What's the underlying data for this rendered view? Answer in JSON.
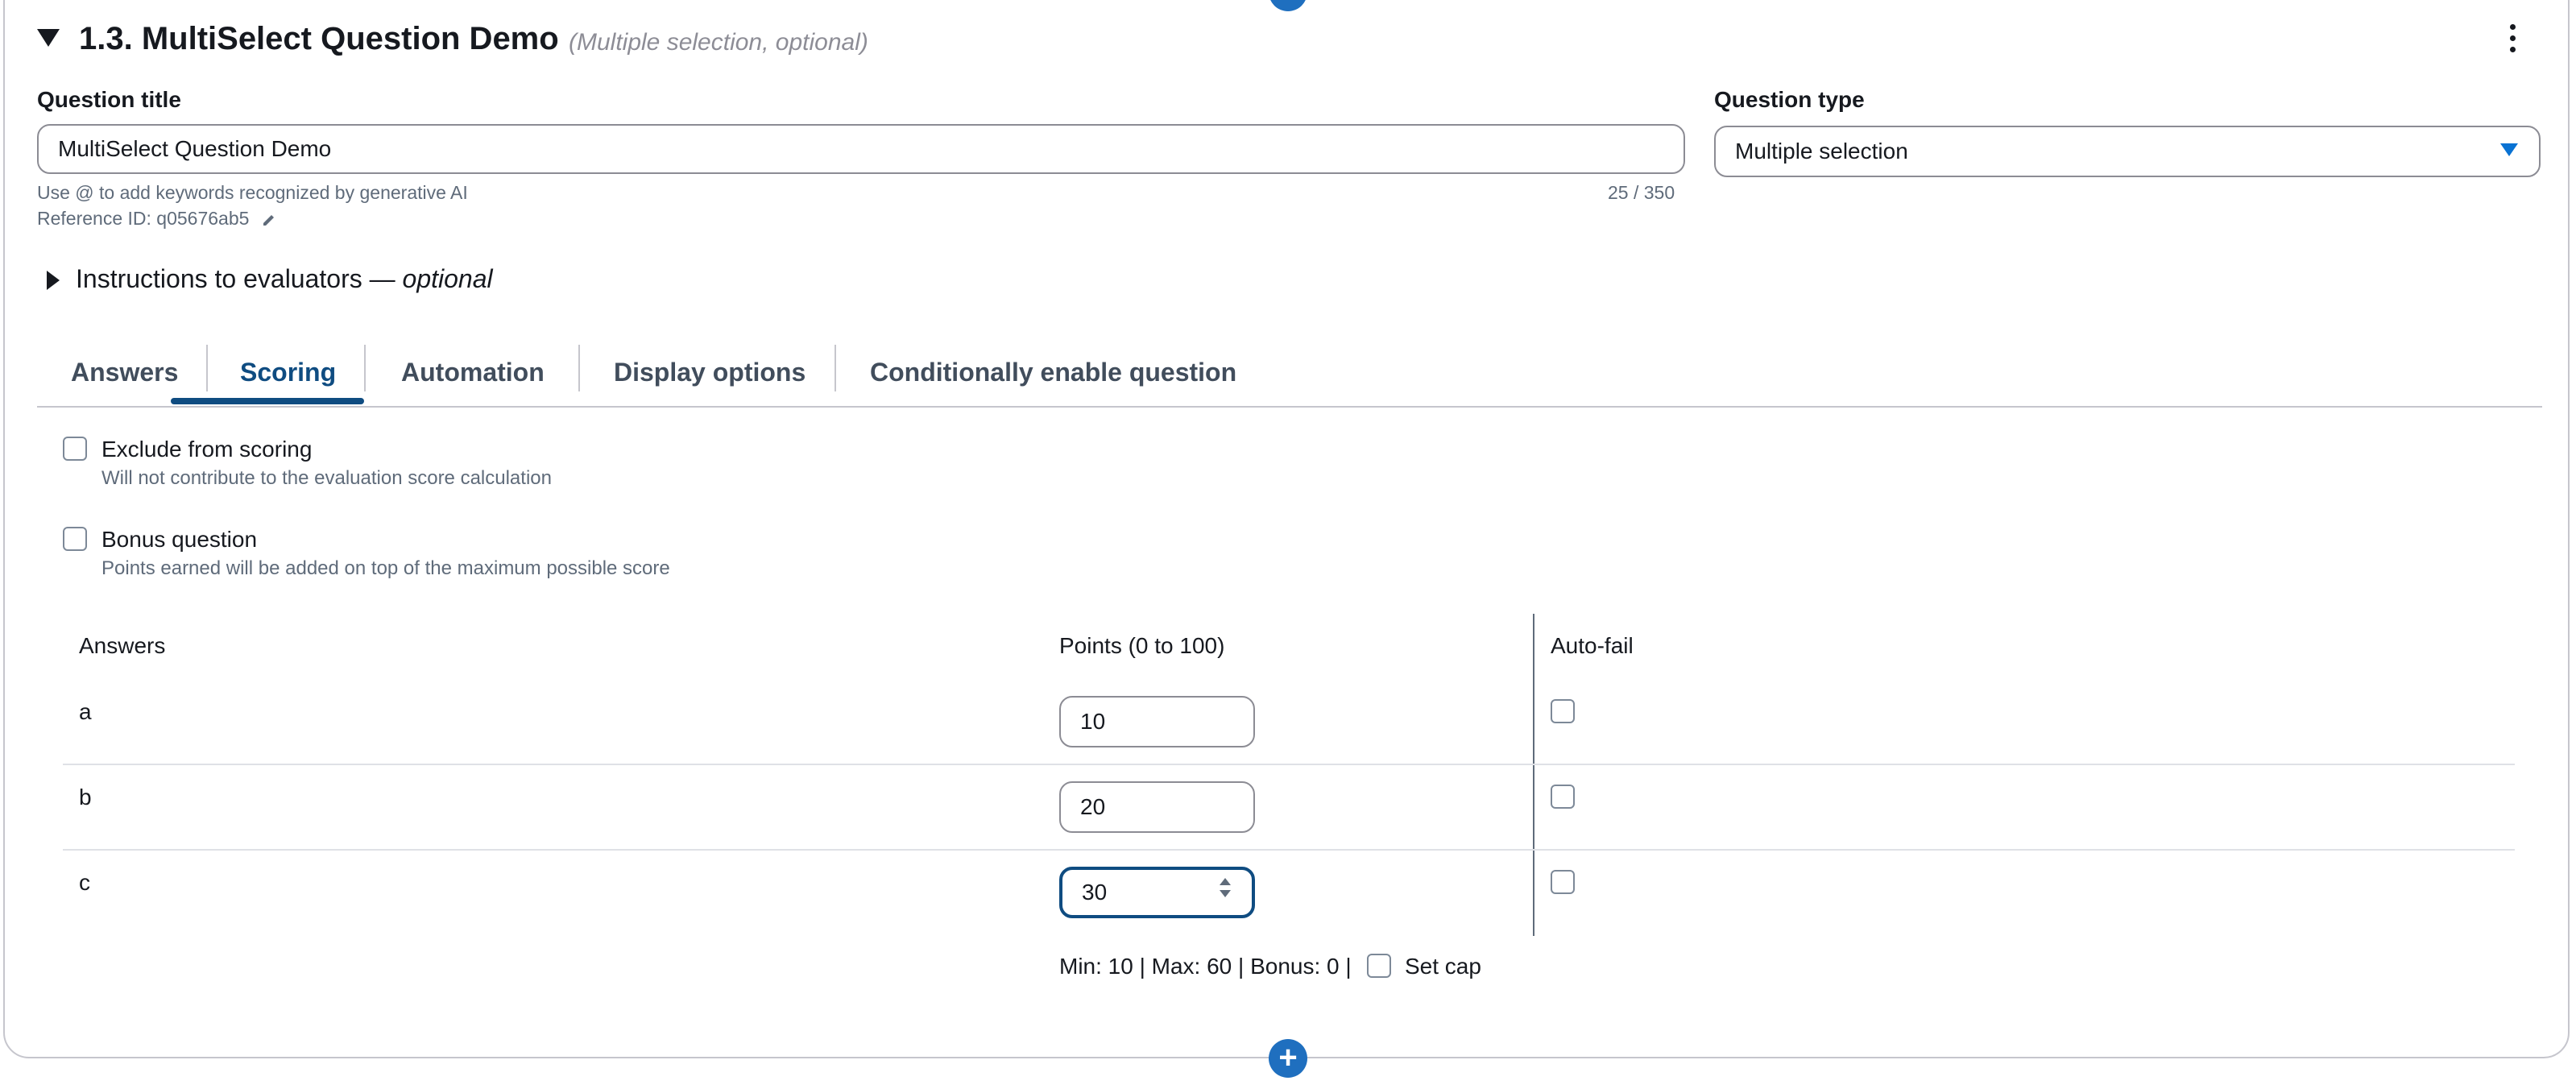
{
  "section": {
    "title": "1.3. MultiSelect Question Demo",
    "subtitle": "(Multiple selection, optional)"
  },
  "question_title": {
    "label": "Question title",
    "value": "MultiSelect Question Demo",
    "hint": "Use @ to add keywords recognized by generative AI",
    "counter": "25 / 350",
    "reference_id": "Reference ID: q05676ab5"
  },
  "question_type": {
    "label": "Question type",
    "value": "Multiple selection"
  },
  "instructions": {
    "label": "Instructions to evaluators —",
    "optional": "optional"
  },
  "tabs": [
    {
      "label": "Answers"
    },
    {
      "label": "Scoring"
    },
    {
      "label": "Automation"
    },
    {
      "label": "Display options"
    },
    {
      "label": "Conditionally enable question"
    }
  ],
  "active_tab": "Scoring",
  "exclude": {
    "label": "Exclude from scoring",
    "description": "Will not contribute to the evaluation score calculation",
    "checked": false
  },
  "bonus": {
    "label": "Bonus question",
    "description": "Points earned will be added on top of the maximum possible score",
    "checked": false
  },
  "table": {
    "headers": {
      "answers": "Answers",
      "points": "Points (0 to 100)",
      "autofail": "Auto-fail"
    },
    "rows": [
      {
        "answer": "a",
        "points": "10",
        "autofail": false
      },
      {
        "answer": "b",
        "points": "20",
        "autofail": false
      },
      {
        "answer": "c",
        "points": "30",
        "autofail": false
      }
    ]
  },
  "summary": {
    "text": "Min: 10 | Max: 60 | Bonus: 0 |",
    "set_cap_label": "Set cap",
    "set_cap_checked": false
  },
  "colors": {
    "accent": "#0f4c81",
    "add_button": "#1f6fbf",
    "border": "#8c8c94",
    "muted_text": "#5f6b7a"
  },
  "icons": [
    "add-icon",
    "caret-down-icon",
    "more-vertical-icon",
    "pencil-icon",
    "caret-right-icon",
    "spinner-icon"
  ]
}
